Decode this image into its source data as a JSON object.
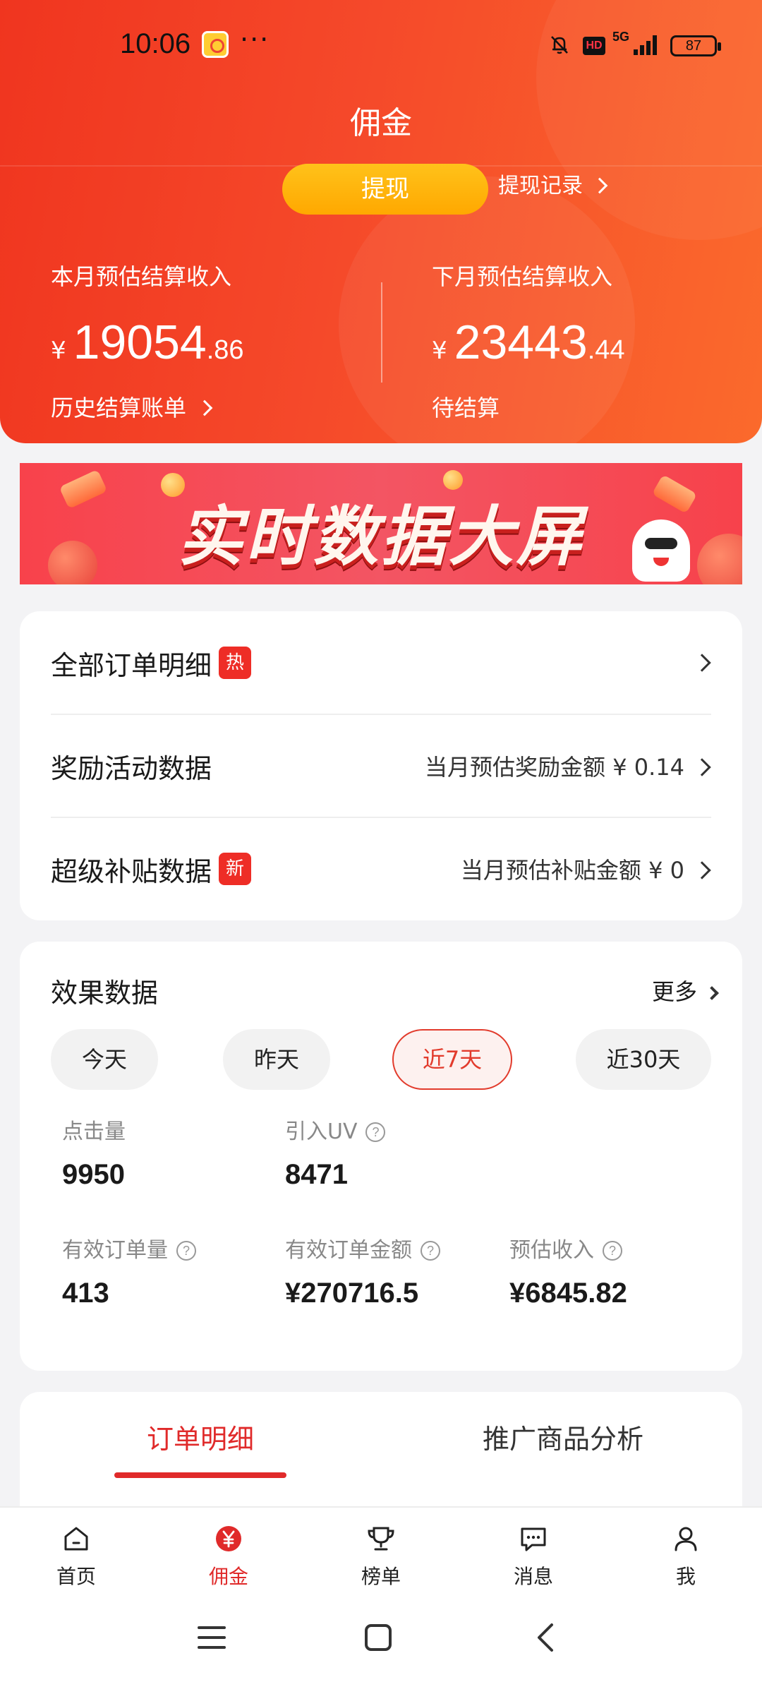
{
  "status_bar": {
    "time": "10:06",
    "dots": "···",
    "hd": "HD",
    "network": "5G",
    "battery": "87"
  },
  "page": {
    "title": "佣金"
  },
  "withdraw": {
    "button_label": "提现",
    "record_label": "提现记录"
  },
  "earnings": {
    "this_month": {
      "label": "本月预估结算收入",
      "currency": "¥",
      "integer": "19054",
      "decimal": ".86",
      "link": "历史结算账单"
    },
    "next_month": {
      "label": "下月预估结算收入",
      "currency": "¥",
      "integer": "23443",
      "decimal": ".44",
      "link": "待结算"
    }
  },
  "banner": {
    "text": "实时数据大屏"
  },
  "links": [
    {
      "label": "全部订单明细",
      "badge": "热",
      "right_text": ""
    },
    {
      "label": "奖励活动数据",
      "badge": "",
      "right_text": "当月预估奖励金额 ¥ 0.14"
    },
    {
      "label": "超级补贴数据",
      "badge": "新",
      "right_text": "当月预估补贴金额 ¥ 0"
    }
  ],
  "effect": {
    "title": "效果数据",
    "more": "更多",
    "ranges": [
      "今天",
      "昨天",
      "近7天",
      "近30天"
    ],
    "active_range": "近7天",
    "metrics": [
      {
        "label": "点击量",
        "value": "9950"
      },
      {
        "label": "引入UV",
        "value": "8471"
      },
      {
        "label": "有效订单量",
        "value": "413"
      },
      {
        "label": "有效订单金额",
        "value": "¥270716.5"
      },
      {
        "label": "预估收入",
        "value": "¥6845.82"
      }
    ],
    "help_glyph": "?"
  },
  "order_tabs": [
    "订单明细",
    "推广商品分析"
  ],
  "bottom_nav": [
    {
      "label": "首页",
      "icon": "home-icon"
    },
    {
      "label": "佣金",
      "icon": "yen-icon"
    },
    {
      "label": "榜单",
      "icon": "trophy-icon"
    },
    {
      "label": "消息",
      "icon": "message-icon"
    },
    {
      "label": "我",
      "icon": "user-icon"
    }
  ],
  "colors": {
    "brand_red": "#e02a2a",
    "header_start": "#f0351f",
    "header_end": "#fb6a2c",
    "withdraw_yellow": "#ffb20e",
    "badge_red": "#ee2d26"
  }
}
